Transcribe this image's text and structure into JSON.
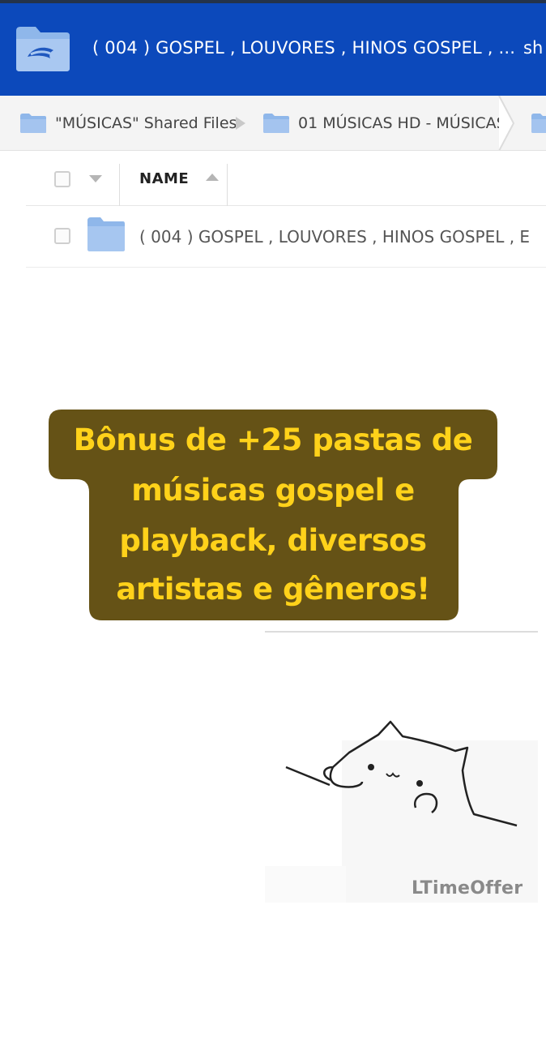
{
  "header": {
    "title": "( 004 ) GOSPEL , LOUVORES , HINOS GOSPEL , ...",
    "share_label": "sh",
    "background": "#0c49bb",
    "logo_icon": "folder-icon"
  },
  "breadcrumb": {
    "items": [
      {
        "label": "\"MÚSICAS\" Shared Files",
        "icon": "folder-icon"
      },
      {
        "label": "01 MÚSICAS HD - MÚSICAS",
        "icon": "folder-icon"
      }
    ]
  },
  "table": {
    "name_header": "NAME",
    "rows": [
      {
        "name": "( 004 ) GOSPEL , LOUVORES , HINOS GOSPEL , E",
        "icon": "folder-icon"
      }
    ]
  },
  "promo": {
    "lines": [
      "Bônus de +25 pastas de",
      "músicas gospel e",
      "playback, diversos",
      "artistas e gêneros!"
    ],
    "text_color": "#ffd21a",
    "background": "#655216"
  },
  "meme": {
    "watermark": "LTimeOffer",
    "image": "bongo-cat-drawing"
  }
}
